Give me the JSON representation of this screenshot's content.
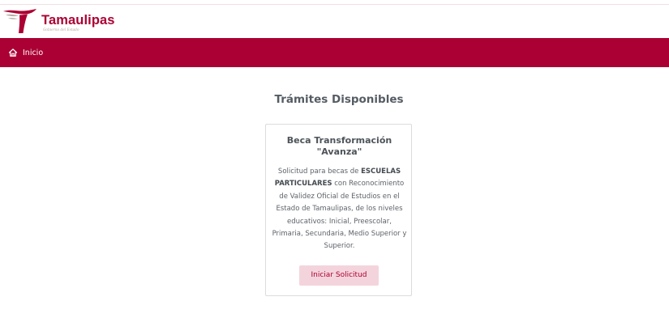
{
  "header": {
    "logo": {
      "name": "Tamaulipas",
      "subtitle": "Gobierno del Estado"
    }
  },
  "nav": {
    "home": {
      "icon": "home-icon",
      "label": "Inicio"
    }
  },
  "main": {
    "title": "Trámites Disponibles",
    "cards": [
      {
        "title_line1": "Beca Transformación",
        "title_line2": "\"Avanza\"",
        "desc_before": "Solicitud para becas de",
        "desc_bold": "ESCUELAS PARTICULARES",
        "desc_after": "con Reconocimiento de Validez Oficial de Estudios en el Estado de Tamaulipas, de los niveles educativos: Inicial, Preescolar, Primaria, Secundaria, Medio Superior y Superior.",
        "button_label": "Iniciar Solicitud"
      }
    ]
  },
  "colors": {
    "brand": "#ab0033",
    "button_bg": "#f4d4dc",
    "logo_gray": "#b3a79f"
  }
}
